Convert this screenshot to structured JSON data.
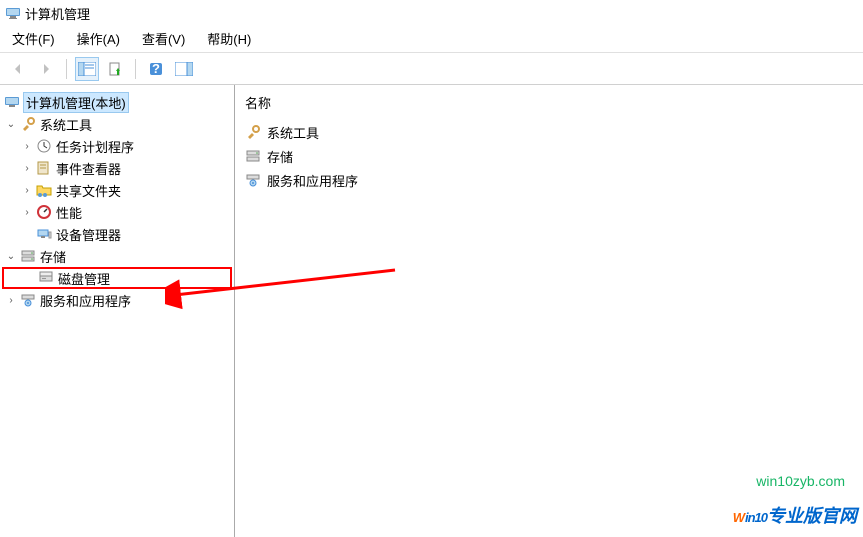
{
  "window": {
    "title": "计算机管理"
  },
  "menu": {
    "file": "文件(F)",
    "action": "操作(A)",
    "view": "查看(V)",
    "help": "帮助(H)"
  },
  "tree": {
    "root": "计算机管理(本地)",
    "system_tools": "系统工具",
    "task_scheduler": "任务计划程序",
    "event_viewer": "事件查看器",
    "shared_folders": "共享文件夹",
    "performance": "性能",
    "device_manager": "设备管理器",
    "storage": "存储",
    "disk_management": "磁盘管理",
    "services_apps": "服务和应用程序"
  },
  "content": {
    "header": "名称",
    "items": [
      "系统工具",
      "存储",
      "服务和应用程序"
    ]
  },
  "watermark": {
    "url": "win10zyb.com"
  },
  "brand": {
    "pre": "W",
    "mid": "in10",
    "cn": "专业版官网"
  }
}
